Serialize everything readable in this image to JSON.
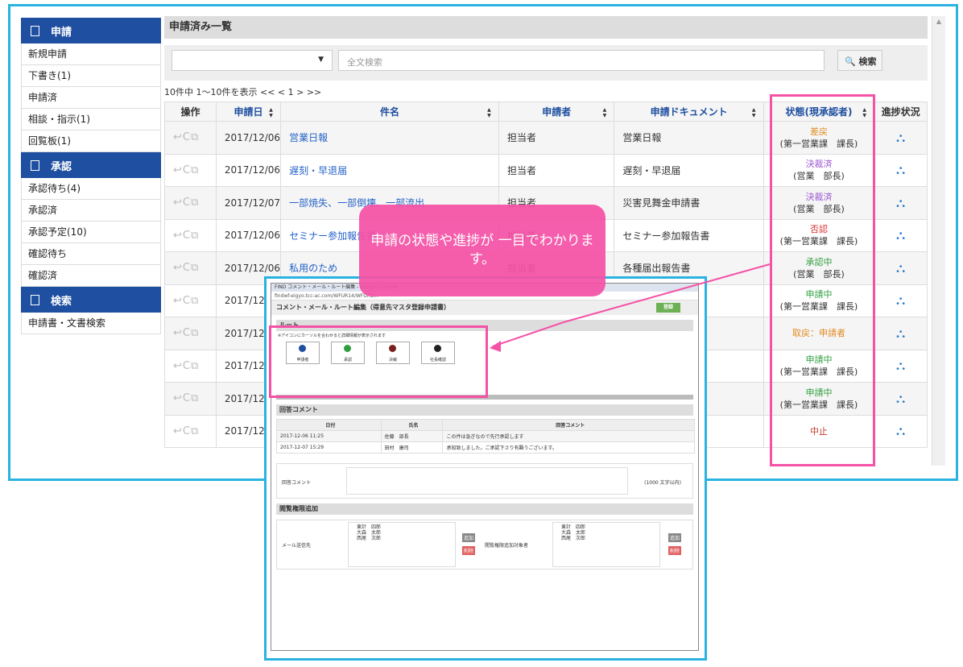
{
  "sidebar": {
    "sections": [
      {
        "title": "申請",
        "items": [
          "新規申請",
          "下書き(1)",
          "申請済",
          "相談・指示(1)",
          "回覧板(1)"
        ]
      },
      {
        "title": "承認",
        "items": [
          "承認待ち(4)",
          "承認済",
          "承認予定(10)",
          "確認待ち",
          "確認済"
        ]
      },
      {
        "title": "検索",
        "items": [
          "申請書・文書検索"
        ]
      }
    ]
  },
  "main": {
    "title": "申請済み一覧",
    "search_placeholder": "全文検索",
    "search_button": "検索",
    "count": "10件中 1〜10件を表示  << < 1 > >>",
    "columns": [
      "操作",
      "申請日",
      "件名",
      "申請者",
      "申請ドキュメント",
      "状態(現承認者)",
      "進捗状況"
    ],
    "rows": [
      {
        "date": "2017/12/06",
        "subject": "営業日報",
        "applicant": "担当者",
        "doc": "営業日報",
        "status": "差戻",
        "approver": "(第一営業課　課長)"
      },
      {
        "date": "2017/12/06",
        "subject": "遅刻・早退届",
        "applicant": "担当者",
        "doc": "遅刻・早退届",
        "status": "決裁済",
        "approver": "(営業　部長)"
      },
      {
        "date": "2017/12/07",
        "subject": "一部焼失、一部倒壊、一部流出",
        "applicant": "担当者",
        "doc": "災害見舞金申請書",
        "status": "決裁済",
        "approver": "(営業　部長)"
      },
      {
        "date": "2017/12/06",
        "subject": "セミナー参加報告書",
        "applicant": "担当者",
        "doc": "セミナー参加報告書",
        "status": "否認",
        "approver": "(第一営業課　課長)"
      },
      {
        "date": "2017/12/06",
        "subject": "私用のため",
        "applicant": "担当者",
        "doc": "各種届出報告書",
        "status": "承認中",
        "approver": "(営業　部長)"
      },
      {
        "date": "2017/12",
        "subject": "",
        "applicant": "",
        "doc": "",
        "status": "申請中",
        "approver": "(第一営業課　課長)"
      },
      {
        "date": "2017/12",
        "subject": "",
        "applicant": "",
        "doc": "",
        "status": "取戻：申請者",
        "approver": ""
      },
      {
        "date": "2017/12",
        "subject": "",
        "applicant": "",
        "doc": "",
        "status": "申請中",
        "approver": "(第一営業課　課長)"
      },
      {
        "date": "2017/12",
        "subject": "",
        "applicant": "",
        "doc": "",
        "status": "申請中",
        "approver": "(第一営業課　課長)"
      },
      {
        "date": "2017/12",
        "subject": "",
        "applicant": "",
        "doc": "",
        "status": "中止",
        "approver": ""
      }
    ]
  },
  "callout": "申請の状態や進捗が 一目でわかります。",
  "popup": {
    "window_title": "FIND コメント・メール・ルート編集 - Google Chrome",
    "url": "findwf-eigyo.tcc-ac.com/WFUR14/WFUR1...",
    "header": "コメント・メール・ルート編集（得意先マスタ登録申請書）",
    "register": "登録",
    "route_title": "ルート",
    "route_hint": "※アイコンにカーソルを合わせると詳細情報が表示されます",
    "route_nodes": [
      "申請者",
      "承認",
      "決裁",
      "社長確認"
    ],
    "comments_title": "回答コメント",
    "comment_cols": [
      "日付",
      "氏名",
      "回答コメント"
    ],
    "comments": [
      [
        "2017-12-06 11:25",
        "佐藤　部長",
        "この件は急ぎなので先行承認します"
      ],
      [
        "2017-12-07 15:29",
        "田村　康司",
        "承知致しました。ご承認下さり有難うございます。"
      ]
    ],
    "comment_label": "回答コメント",
    "comment_limit": "(1000 文字以内)",
    "access_title": "閲覧権限追加",
    "mail_label": "メール送信先",
    "access_label": "閲覧権限追加対象者",
    "names": [
      "東計　四郎",
      "大森　太郎",
      "西尾　次郎"
    ],
    "add": "追加",
    "delete": "削除"
  }
}
